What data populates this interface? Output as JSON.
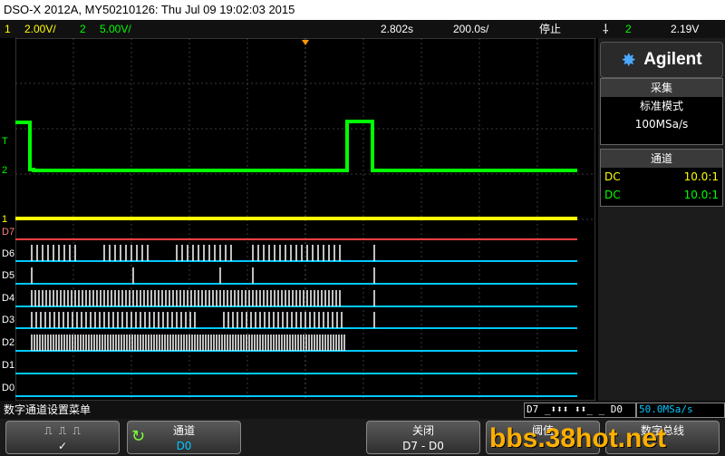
{
  "titlebar": {
    "text": "DSO-X 2012A, MY50210126: Thu Jul 09 19:02:03 2015"
  },
  "status": {
    "ch1_num": "1",
    "ch1_scale": "2.00V/",
    "ch2_num": "2",
    "ch2_scale": "5.00V/",
    "time_pos": "2.802s",
    "time_scale": "200.0s/",
    "run_state": "停止",
    "trigger_icon": "trigger-edge-icon",
    "trig_ch": "2",
    "trig_level": "2.19V"
  },
  "channel_labels": [
    "T",
    "2",
    "1",
    "D7",
    "D6",
    "D5",
    "D4",
    "D3",
    "D2",
    "D1",
    "D0"
  ],
  "side": {
    "brand": "Agilent",
    "acq_title": "采集",
    "acq_mode": "标准模式",
    "acq_rate": "100MSa/s",
    "chan_title": "通道",
    "channels": [
      {
        "coupling": "DC",
        "probe": "10.0:1",
        "color": "#ffff00"
      },
      {
        "coupling": "DC",
        "probe": "10.0:1",
        "color": "#00ff00"
      }
    ]
  },
  "bottom": {
    "menu_title": "数字通道设置菜单",
    "digital_state": "D7 _⬍⬍⬍ ⬍⬍_ _ D0",
    "sample_rate": "50.0MSa/s"
  },
  "softkeys": {
    "threshold_icon": "threshold-waveform-icon",
    "channel_label": "通道",
    "channel_value": "D0",
    "off_label": "关闭",
    "off_value": "D7 - D0",
    "thresh_label": "阈值",
    "bus_label": "数字总线"
  },
  "watermark": "bbs.38hot.net",
  "colors": {
    "ch1": "#ffff00",
    "ch2": "#00ff00",
    "digital": "#00c8ff",
    "d7": "#ff4040"
  }
}
